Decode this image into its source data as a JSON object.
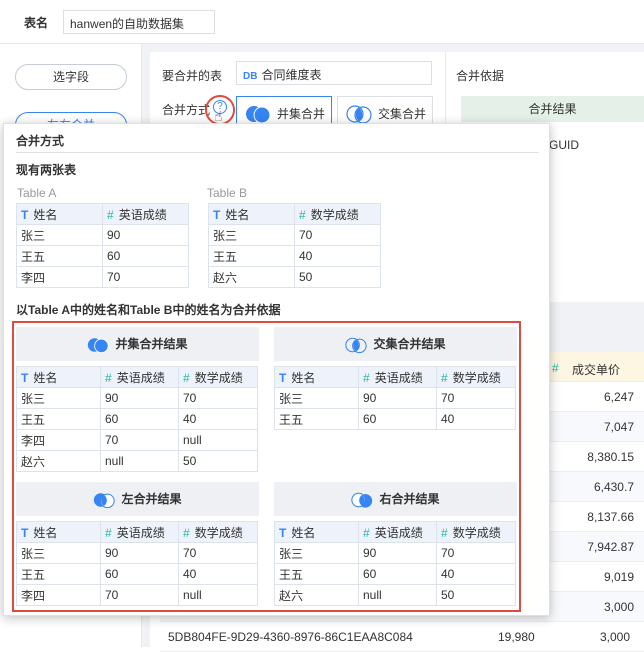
{
  "top": {
    "label": "表名",
    "name": "hanwen的自助数据集"
  },
  "left": {
    "pill1": "选字段",
    "pill2": "左右合并"
  },
  "main": {
    "table_label": "要合并的表",
    "table_prefix": "DB",
    "table_value": "合同维度表",
    "mode_label": "合并方式",
    "help": "?",
    "btn_union": "并集合并",
    "btn_inter": "交集合并"
  },
  "right": {
    "title": "合并依据",
    "result": "合并结果",
    "guid": "GUID"
  },
  "grid": {
    "header": "成交单价",
    "values": [
      "6,247",
      "7,047",
      "8,380.15",
      "6,430.7",
      "8,137.66",
      "7,942.87",
      "9,019",
      "3,000"
    ],
    "last_id": "5DB804FE-9D29-4360-8976-86C1EAA8C084",
    "last_amt": "19,980",
    "last_price": "3,000"
  },
  "popup": {
    "title": "合并方式",
    "sub1": "现有两张表",
    "tableA": "Table A",
    "tableB": "Table B",
    "sub2": "以Table A中的姓名和Table B中的姓名为合并依据",
    "col_name": "姓名",
    "col_eng": "英语成绩",
    "col_math": "数学成绩",
    "a_rows": [
      [
        "张三",
        "90"
      ],
      [
        "王五",
        "60"
      ],
      [
        "李四",
        "70"
      ]
    ],
    "b_rows": [
      [
        "张三",
        "70"
      ],
      [
        "王五",
        "40"
      ],
      [
        "赵六",
        "50"
      ]
    ],
    "union_title": "并集合并结果",
    "inter_title": "交集合并结果",
    "left_title": "左合并结果",
    "right_title": "右合并结果",
    "union_rows": [
      [
        "张三",
        "90",
        "70"
      ],
      [
        "王五",
        "60",
        "40"
      ],
      [
        "李四",
        "70",
        "null"
      ],
      [
        "赵六",
        "null",
        "50"
      ]
    ],
    "inter_rows": [
      [
        "张三",
        "90",
        "70"
      ],
      [
        "王五",
        "60",
        "40"
      ]
    ],
    "left_rows": [
      [
        "张三",
        "90",
        "70"
      ],
      [
        "王五",
        "60",
        "40"
      ],
      [
        "李四",
        "70",
        "null"
      ]
    ],
    "right_rows": [
      [
        "张三",
        "90",
        "70"
      ],
      [
        "王五",
        "60",
        "40"
      ],
      [
        "赵六",
        "null",
        "50"
      ]
    ]
  },
  "colors": {
    "accent": "#3685f2",
    "highlight": "#e04b3f",
    "num_icon": "#1fb7a5"
  }
}
